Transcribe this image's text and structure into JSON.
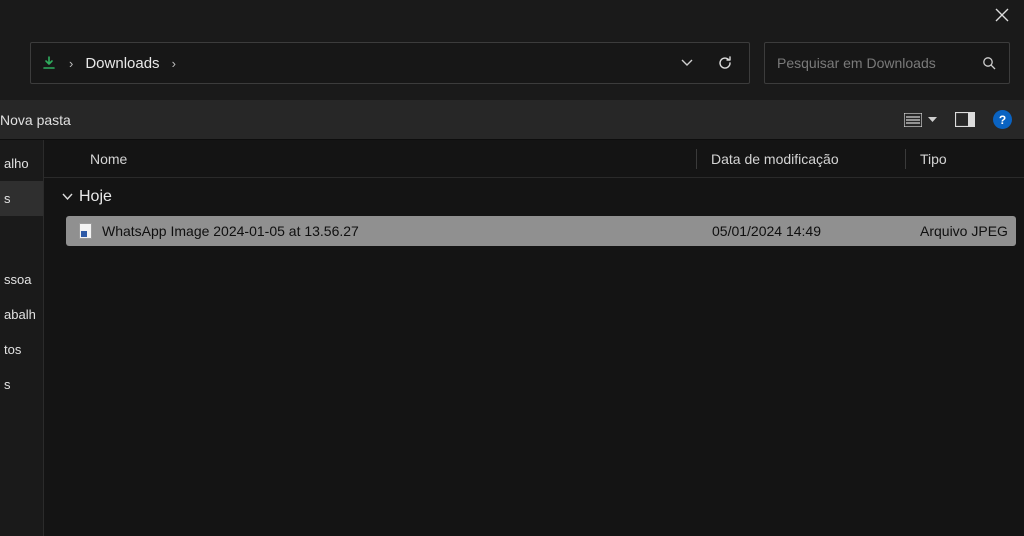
{
  "titlebar": {
    "close_label": "Close"
  },
  "address": {
    "crumb": "Downloads",
    "refresh_label": "Refresh"
  },
  "search": {
    "placeholder": "Pesquisar em Downloads"
  },
  "toolstrip": {
    "new_folder": "Nova pasta",
    "view_label": "View",
    "preview_label": "Preview pane",
    "help_label": "?"
  },
  "nav": {
    "items": [
      {
        "label": "alho",
        "selected": false
      },
      {
        "label": "s",
        "selected": true
      }
    ],
    "items2": [
      {
        "label": "ssoa"
      },
      {
        "label": "abalh"
      },
      {
        "label": "tos"
      },
      {
        "label": "s"
      }
    ]
  },
  "columns": {
    "name": "Nome",
    "date": "Data de modificação",
    "type": "Tipo"
  },
  "group": {
    "label": "Hoje"
  },
  "files": [
    {
      "name": "WhatsApp Image 2024-01-05 at 13.56.27",
      "date": "05/01/2024 14:49",
      "type": "Arquivo JPEG",
      "selected": true
    }
  ]
}
